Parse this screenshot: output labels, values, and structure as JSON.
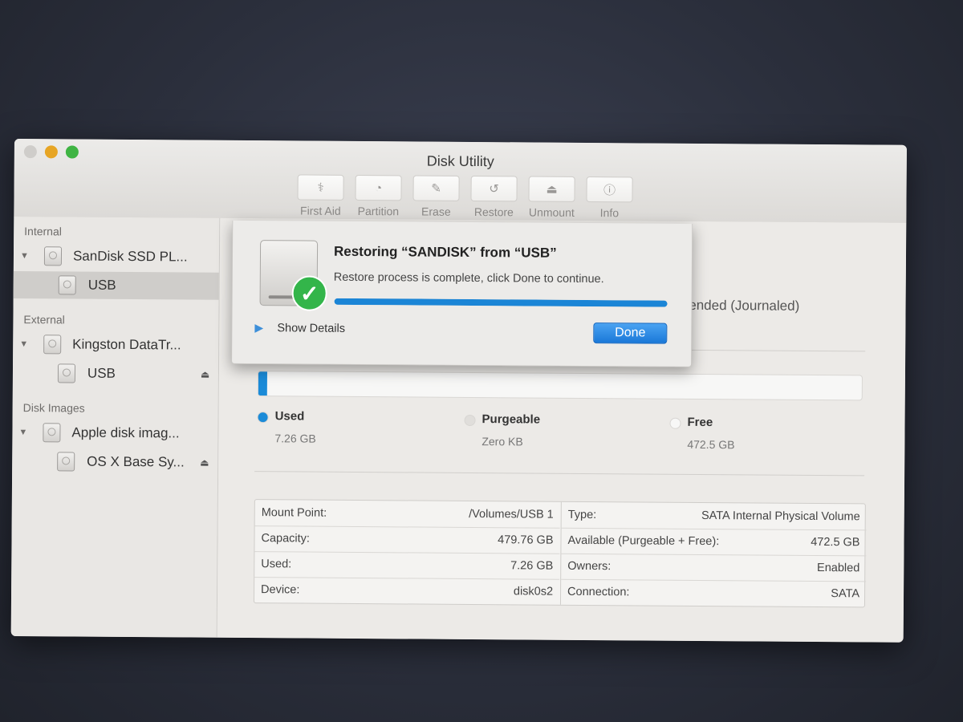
{
  "window": {
    "title": "Disk Utility"
  },
  "toolbar": [
    {
      "label": "First Aid",
      "icon": "stethoscope-icon"
    },
    {
      "label": "Partition",
      "icon": "pie-icon"
    },
    {
      "label": "Erase",
      "icon": "eraser-icon"
    },
    {
      "label": "Restore",
      "icon": "restore-icon"
    },
    {
      "label": "Unmount",
      "icon": "unmount-icon"
    },
    {
      "label": "Info",
      "icon": "info-icon"
    }
  ],
  "sidebar": {
    "sections": [
      {
        "header": "Internal",
        "items": [
          {
            "label": "SanDisk SSD PL...",
            "level": 0,
            "selected": false
          },
          {
            "label": "USB",
            "level": 1,
            "selected": true
          }
        ]
      },
      {
        "header": "External",
        "items": [
          {
            "label": "Kingston DataTr...",
            "level": 0
          },
          {
            "label": "USB",
            "level": 1,
            "eject": true
          }
        ]
      },
      {
        "header": "Disk Images",
        "items": [
          {
            "label": "Apple disk imag...",
            "level": 0
          },
          {
            "label": "OS X Base Sy...",
            "level": 1,
            "eject": true
          }
        ]
      }
    ]
  },
  "main": {
    "format_text": "tended (Journaled)",
    "usage": {
      "used_fraction": 0.015,
      "used_color": "#1b8bd8",
      "legend": [
        {
          "name": "Used",
          "value": "7.26 GB",
          "color": "#1b8bd8"
        },
        {
          "name": "Purgeable",
          "value": "Zero KB",
          "color": "#e0dedb"
        },
        {
          "name": "Free",
          "value": "472.5 GB",
          "color": "#f7f7f6"
        }
      ]
    },
    "info_left": [
      {
        "key": "Mount Point:",
        "value": "/Volumes/USB 1"
      },
      {
        "key": "Capacity:",
        "value": "479.76 GB"
      },
      {
        "key": "Used:",
        "value": "7.26 GB"
      },
      {
        "key": "Device:",
        "value": "disk0s2"
      }
    ],
    "info_right": [
      {
        "key": "Type:",
        "value": "SATA Internal Physical Volume"
      },
      {
        "key": "Available (Purgeable + Free):",
        "value": "472.5 GB"
      },
      {
        "key": "Owners:",
        "value": "Enabled"
      },
      {
        "key": "Connection:",
        "value": "SATA"
      }
    ]
  },
  "sheet": {
    "title": "Restoring “SANDISK” from “USB”",
    "message": "Restore process is complete, click Done to continue.",
    "progress": 1.0,
    "details_label": "Show Details",
    "done_label": "Done"
  }
}
